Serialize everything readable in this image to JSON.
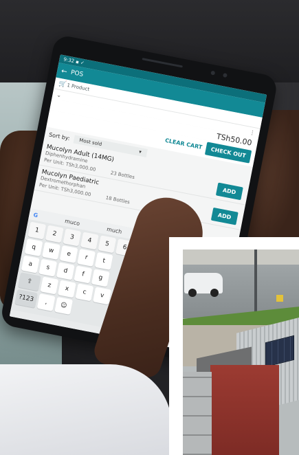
{
  "tablet_screen": {
    "app_title": "POS",
    "cart_summary": "1 Product",
    "total": "TSh50.00",
    "clear_cart_label": "CLEAR CART",
    "checkout_label": "CHECK OUT",
    "sort_by_label": "Sort by:",
    "sort_value": "Most sold",
    "products": [
      {
        "name": "Mucolyn Adult (14MG)",
        "generic": "Diphenhydramine",
        "per_unit": "Per Unit: TSh3,000.00",
        "stock": "23 Bottles",
        "add_label": "ADD"
      },
      {
        "name": "Mucolyn Paediatric",
        "generic": "Dextromethorphan",
        "per_unit": "Per Unit: TSh3,000.00",
        "stock": "18 Bottles",
        "add_label": "ADD"
      }
    ],
    "keyboard": {
      "suggestions": [
        "muco",
        "much"
      ],
      "row_numbers": [
        "1",
        "2",
        "3",
        "4",
        "5",
        "6"
      ],
      "row_q": [
        "q",
        "w",
        "e",
        "r",
        "t"
      ],
      "row_a": [
        "a",
        "s",
        "d",
        "f",
        "g"
      ],
      "row_z": [
        "z",
        "x",
        "c",
        "v",
        "b"
      ],
      "mode_key": "?123",
      "comma_key": ",",
      "emoji_key": "☺"
    }
  },
  "icons": [
    "back-arrow-icon",
    "cart-icon",
    "chevron-down-icon",
    "more-vert-icon",
    "google-g-icon",
    "shift-icon",
    "nav-back-icon"
  ],
  "colors": {
    "app_primary": "#128995",
    "app_status_bar": "#0c6f7a",
    "inset_wall": "#9c3b32",
    "grass": "#5d8c3a"
  }
}
